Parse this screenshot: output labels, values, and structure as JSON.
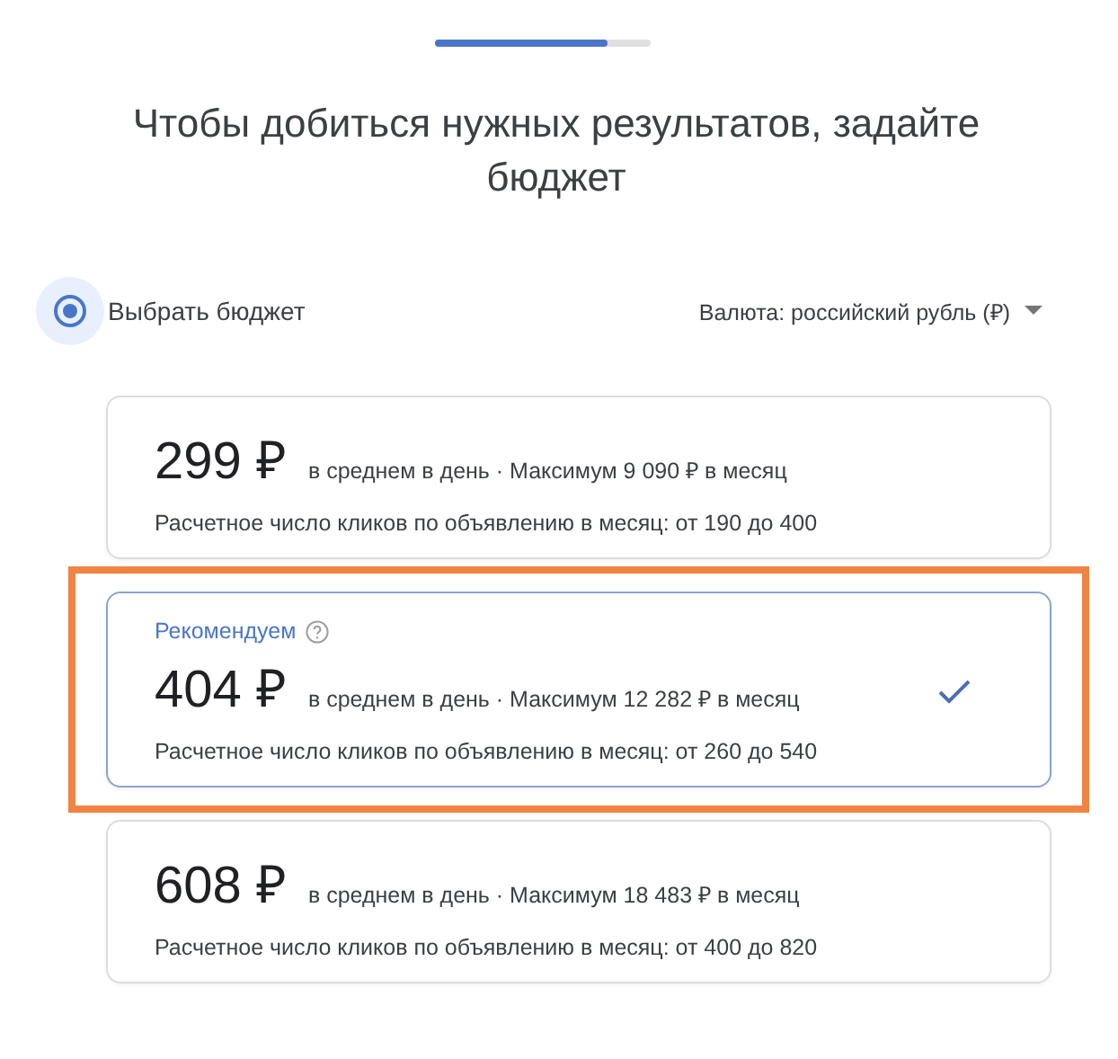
{
  "progress": {
    "level": 0.8
  },
  "title": "Чтобы добиться нужных результатов, задайте бюджет",
  "budget_choice": {
    "label": "Выбрать бюджет",
    "selected": true
  },
  "currency": {
    "label": "Валюта: российский рубль (₽)"
  },
  "options": [
    {
      "price": "299 ₽",
      "details": "в среднем в день · Максимум 9 090 ₽ в месяц",
      "clicks": "Расчетное число кликов по объявлению в месяц: от 190 до 400",
      "selected": false
    },
    {
      "badge": "Рекомендуем",
      "price": "404 ₽",
      "details": "в среднем в день · Максимум 12 282 ₽ в месяц",
      "clicks": "Расчетное число кликов по объявлению в месяц: от 260 до 540",
      "selected": true
    },
    {
      "price": "608 ₽",
      "details": "в среднем в день · Максимум 18 483 ₽ в месяц",
      "clicks": "Расчетное число кликов по объявлению в месяц: от 400 до 820",
      "selected": false
    }
  ]
}
